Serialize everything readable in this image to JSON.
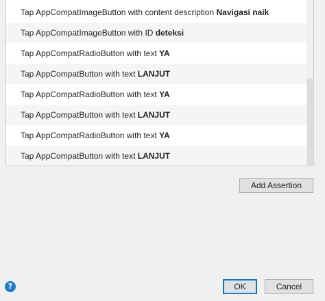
{
  "steps": [
    {
      "prefix": "Tap AppCompatImageButton with content description ",
      "value": "Navigasi naik"
    },
    {
      "prefix": "Tap AppCompatImageButton with ID ",
      "value": "deteksi"
    },
    {
      "prefix": "Tap AppCompatRadioButton with text ",
      "value": "YA"
    },
    {
      "prefix": "Tap AppCompatButton with text ",
      "value": "LANJUT"
    },
    {
      "prefix": "Tap AppCompatRadioButton with text ",
      "value": "YA"
    },
    {
      "prefix": "Tap AppCompatButton with text ",
      "value": "LANJUT"
    },
    {
      "prefix": "Tap AppCompatRadioButton with text ",
      "value": "YA"
    },
    {
      "prefix": "Tap AppCompatButton with text ",
      "value": "LANJUT"
    }
  ],
  "buttons": {
    "add_assertion": "Add Assertion",
    "ok": "OK",
    "cancel": "Cancel"
  },
  "help": {
    "icon": "help-icon",
    "glyph": "?"
  },
  "colors": {
    "help_icon": "#1c7ccf",
    "default_button_border": "#0078d7"
  }
}
